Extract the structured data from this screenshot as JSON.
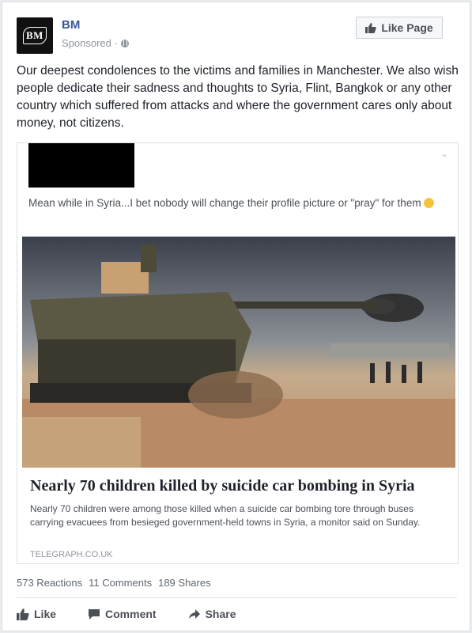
{
  "post": {
    "page_name": "BM",
    "avatar_text": "BM",
    "sponsored_label": "Sponsored ·",
    "like_page_label": "Like Page",
    "text": "Our deepest condolences to the victims and families in Manchester. We also wish people dedicate their sadness and thoughts to Syria, Flint, Bangkok or any other country which suffered from attacks and where the government cares only about money, not citizens."
  },
  "shared": {
    "text": "Mean while in Syria...I bet nobody will change their profile picture or \"pray\" for them",
    "headline": "Nearly 70 children killed by suicide car bombing in Syria",
    "summary": "Nearly 70 children were among those killed when a suicide car bombing tore through buses carrying evacuees from besieged government-held towns in Syria, a monitor said on Sunday.",
    "source": "TELEGRAPH.CO.UK"
  },
  "stats": {
    "reactions": "573 Reactions",
    "comments": "11 Comments",
    "shares": "189 Shares"
  },
  "actions": {
    "like": "Like",
    "comment": "Comment",
    "share": "Share"
  },
  "colors": {
    "link": "#365899",
    "muted": "#90949c",
    "action": "#4b4f56"
  }
}
